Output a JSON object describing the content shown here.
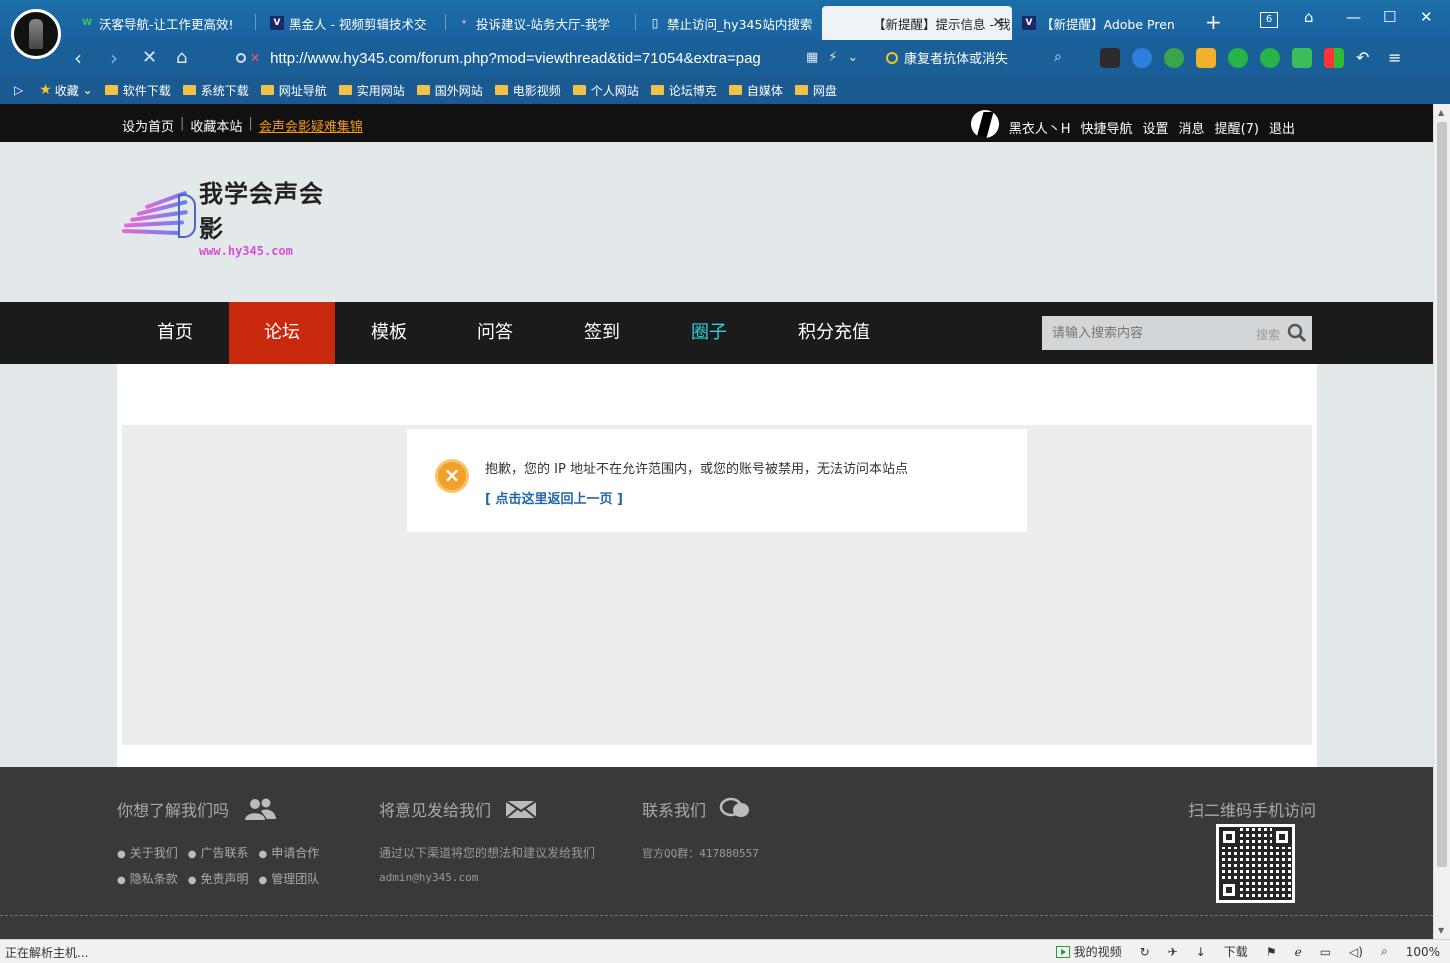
{
  "browser": {
    "tabs": [
      {
        "label": "沃客导航-让工作更高效!",
        "icon": "wk-icon"
      },
      {
        "label": "黑金人 - 视频剪辑技术交",
        "icon": "v-icon"
      },
      {
        "label": "投诉建议-站务大厅-我学",
        "icon": "feather-icon"
      },
      {
        "label": "禁止访问_hy345站内搜索",
        "icon": "page-icon"
      },
      {
        "label": "【新提醒】提示信息 - 我",
        "icon": "page-icon"
      },
      {
        "label": "【新提醒】Adobe Pren",
        "icon": "v-icon"
      }
    ],
    "new_tab": "+",
    "tab_count": "6",
    "url": "http://www.hy345.com/forum.php?mod=viewthread&tid=71054&extra=pag",
    "search_hint": "康复者抗体或消失",
    "bookmarks": [
      "收藏",
      "软件下载",
      "系统下载",
      "网址导航",
      "实用网站",
      "国外网站",
      "电影视频",
      "个人网站",
      "论坛博克",
      "自媒体",
      "网盘"
    ]
  },
  "topbar": {
    "left": [
      "设为首页",
      "收藏本站"
    ],
    "left_highlight": "会声会影疑难集锦",
    "username": "黑衣人丶H",
    "right": [
      "快捷导航",
      "设置",
      "消息",
      "提醒(7)",
      "退出"
    ]
  },
  "logo": {
    "cn": "我学会声会影",
    "en": "www.hy345.com"
  },
  "nav": {
    "items": [
      "首页",
      "论坛",
      "模板",
      "问答",
      "签到",
      "圈子",
      "积分充值"
    ],
    "active": "论坛",
    "search_placeholder": "请输入搜索内容",
    "search_button": "搜索"
  },
  "message": {
    "text": "抱歉，您的 IP 地址不在允许范围内，或您的账号被禁用，无法访问本站点",
    "link": "[ 点击这里返回上一页 ]"
  },
  "footer": {
    "about_title": "你想了解我们吗",
    "about_links_row1": [
      "关于我们",
      "广告联系",
      "申请合作"
    ],
    "about_links_row2": [
      "隐私条款",
      "免责声明",
      "管理团队"
    ],
    "feedback_title": "将意见发给我们",
    "feedback_text": "通过以下渠道将您的想法和建议发给我们",
    "feedback_email": "admin@hy345.com",
    "contact_title": "联系我们",
    "contact_qq": "官方QQ群：417880557",
    "qr_title": "扫二维码手机访问"
  },
  "status": {
    "left": "正在解析主机...",
    "video": "我的视频",
    "download": "下载",
    "zoom": "100%"
  },
  "colors": {
    "accent_red": "#c8280c",
    "teal": "#2fd0d8",
    "orange": "#f39a1c",
    "link": "#2366a8"
  }
}
